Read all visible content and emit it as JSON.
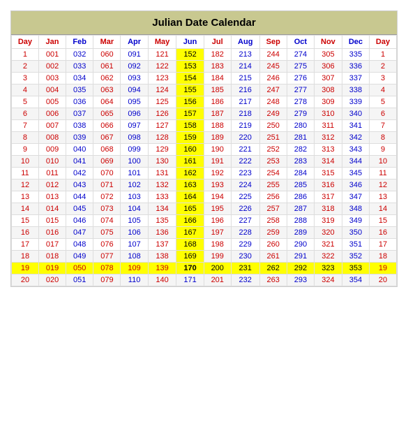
{
  "title": "Julian Date Calendar",
  "headers": [
    "Day",
    "Jan",
    "Feb",
    "Mar",
    "Apr",
    "May",
    "Jun",
    "Jul",
    "Aug",
    "Sep",
    "Oct",
    "Nov",
    "Dec",
    "Day"
  ],
  "rows": [
    {
      "day": 1,
      "vals": [
        "001",
        "032",
        "060",
        "091",
        "121",
        "152",
        "182",
        "213",
        "244",
        "274",
        "305",
        "335"
      ],
      "junHigh": true
    },
    {
      "day": 2,
      "vals": [
        "002",
        "033",
        "061",
        "092",
        "122",
        "153",
        "183",
        "214",
        "245",
        "275",
        "306",
        "336"
      ],
      "junHigh": true
    },
    {
      "day": 3,
      "vals": [
        "003",
        "034",
        "062",
        "093",
        "123",
        "154",
        "184",
        "215",
        "246",
        "276",
        "307",
        "337"
      ],
      "junHigh": true
    },
    {
      "day": 4,
      "vals": [
        "004",
        "035",
        "063",
        "094",
        "124",
        "155",
        "185",
        "216",
        "247",
        "277",
        "308",
        "338"
      ],
      "junHigh": true
    },
    {
      "day": 5,
      "vals": [
        "005",
        "036",
        "064",
        "095",
        "125",
        "156",
        "186",
        "217",
        "248",
        "278",
        "309",
        "339"
      ],
      "junHigh": true
    },
    {
      "day": 6,
      "vals": [
        "006",
        "037",
        "065",
        "096",
        "126",
        "157",
        "187",
        "218",
        "249",
        "279",
        "310",
        "340"
      ],
      "junHigh": true
    },
    {
      "day": 7,
      "vals": [
        "007",
        "038",
        "066",
        "097",
        "127",
        "158",
        "188",
        "219",
        "250",
        "280",
        "311",
        "341"
      ],
      "junHigh": true
    },
    {
      "day": 8,
      "vals": [
        "008",
        "039",
        "067",
        "098",
        "128",
        "159",
        "189",
        "220",
        "251",
        "281",
        "312",
        "342"
      ],
      "junHigh": true
    },
    {
      "day": 9,
      "vals": [
        "009",
        "040",
        "068",
        "099",
        "129",
        "160",
        "190",
        "221",
        "252",
        "282",
        "313",
        "343"
      ],
      "junHigh": true
    },
    {
      "day": 10,
      "vals": [
        "010",
        "041",
        "069",
        "100",
        "130",
        "161",
        "191",
        "222",
        "253",
        "283",
        "314",
        "344"
      ],
      "junHigh": true
    },
    {
      "day": 11,
      "vals": [
        "011",
        "042",
        "070",
        "101",
        "131",
        "162",
        "192",
        "223",
        "254",
        "284",
        "315",
        "345"
      ],
      "junHigh": true
    },
    {
      "day": 12,
      "vals": [
        "012",
        "043",
        "071",
        "102",
        "132",
        "163",
        "193",
        "224",
        "255",
        "285",
        "316",
        "346"
      ],
      "junHigh": true
    },
    {
      "day": 13,
      "vals": [
        "013",
        "044",
        "072",
        "103",
        "133",
        "164",
        "194",
        "225",
        "256",
        "286",
        "317",
        "347"
      ],
      "junHigh": true
    },
    {
      "day": 14,
      "vals": [
        "014",
        "045",
        "073",
        "104",
        "134",
        "165",
        "195",
        "226",
        "257",
        "287",
        "318",
        "348"
      ],
      "junHigh": true
    },
    {
      "day": 15,
      "vals": [
        "015",
        "046",
        "074",
        "105",
        "135",
        "166",
        "196",
        "227",
        "258",
        "288",
        "319",
        "349"
      ],
      "junHigh": true
    },
    {
      "day": 16,
      "vals": [
        "016",
        "047",
        "075",
        "106",
        "136",
        "167",
        "197",
        "228",
        "259",
        "289",
        "320",
        "350"
      ],
      "junHigh": true
    },
    {
      "day": 17,
      "vals": [
        "017",
        "048",
        "076",
        "107",
        "137",
        "168",
        "198",
        "229",
        "260",
        "290",
        "321",
        "351"
      ],
      "junHigh": true
    },
    {
      "day": 18,
      "vals": [
        "018",
        "049",
        "077",
        "108",
        "138",
        "169",
        "199",
        "230",
        "261",
        "291",
        "322",
        "352"
      ],
      "junHigh": true
    },
    {
      "day": 19,
      "vals": [
        "019",
        "050",
        "078",
        "109",
        "139",
        "170",
        "200",
        "231",
        "262",
        "292",
        "323",
        "353"
      ],
      "junHigh": true,
      "rowHigh": true
    },
    {
      "day": 20,
      "vals": [
        "020",
        "051",
        "079",
        "110",
        "140",
        "171",
        "201",
        "232",
        "263",
        "293",
        "324",
        "354"
      ],
      "junHigh": false
    }
  ]
}
